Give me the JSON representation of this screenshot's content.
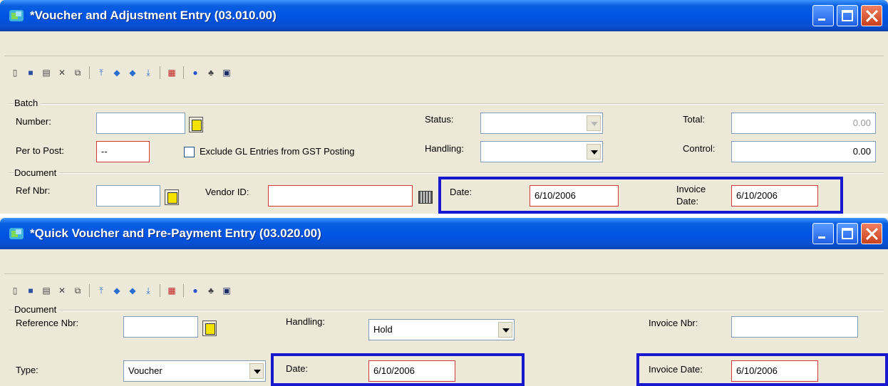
{
  "window1": {
    "title": "*Voucher and Adjustment Entry (03.010.00)",
    "toolbar_icons": [
      "new-icon",
      "save-icon",
      "copy-icon",
      "delete-icon",
      "paste-icon",
      "first-icon",
      "previous-icon",
      "next-icon",
      "last-icon",
      "calendar-icon",
      "help-icon",
      "customize-icon",
      "screen-icon"
    ],
    "batch": {
      "group_label": "Batch",
      "number_label": "Number:",
      "number_value": "",
      "per_to_post_label": "Per to Post:",
      "per_to_post_value": "--",
      "exclude_gl_label": "Exclude GL Entries from GST Posting",
      "exclude_gl_checked": false,
      "status_label": "Status:",
      "status_value": "",
      "handling_label": "Handling:",
      "handling_value": "",
      "total_label": "Total:",
      "total_value": "0.00",
      "control_label": "Control:",
      "control_value": "0.00"
    },
    "document": {
      "group_label": "Document",
      "ref_nbr_label": "Ref Nbr:",
      "ref_nbr_value": "",
      "vendor_id_label": "Vendor ID:",
      "vendor_id_value": "",
      "date_label": "Date:",
      "date_value": "6/10/2006",
      "invoice_date_label_line1": "Invoice",
      "invoice_date_label_line2": "Date:",
      "invoice_date_value": "6/10/2006"
    }
  },
  "window2": {
    "title": "*Quick Voucher and Pre-Payment Entry (03.020.00)",
    "document": {
      "group_label": "Document",
      "reference_nbr_label": "Reference Nbr:",
      "reference_nbr_value": "",
      "handling_label": "Handling:",
      "handling_value": "Hold",
      "invoice_nbr_label": "Invoice Nbr:",
      "invoice_nbr_value": "",
      "type_label": "Type:",
      "type_value": "Voucher",
      "date_label": "Date:",
      "date_value": "6/10/2006",
      "invoice_date_label": "Invoice Date:",
      "invoice_date_value": "6/10/2006"
    }
  },
  "colors": {
    "titlebar": "#0054e3",
    "window_bg": "#ece9d8",
    "highlight_border": "#1818d0",
    "required_border": "#d23a3a"
  }
}
